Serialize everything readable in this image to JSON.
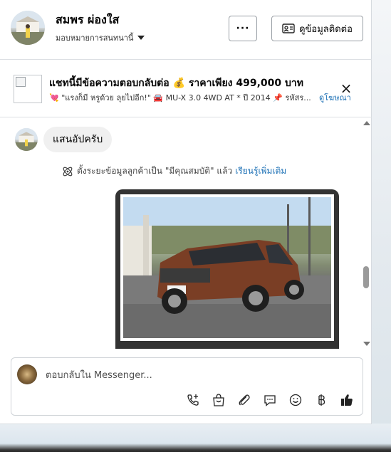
{
  "header": {
    "name": "สมพร ผ่องใส",
    "subtitle": "มอบหมายการสนทนานี้",
    "more_label": "···",
    "contact_label": "ดูข้อมูลติดต่อ"
  },
  "banner": {
    "title": "แชทนี้มีข้อความตอบกลับต่อ 💰 ราคาเพียง 499,000 บาท",
    "detail": "💘 \"แรงก็มี หรูด้วย ลุยไปอีก!\" 🚘 MU-X 3.0 4WD AT * ปี 2014 📌 รหัสร...",
    "link": "ดูโฆษณา",
    "close_label": "×"
  },
  "messages": {
    "bubble_text": "แสนอัปครับ",
    "system_text": "ตั้งระยะข้อมูลลูกค้าเป็น \"มีคุณสมบัติ\" แล้ว",
    "system_link": "เรียนรู้เพิ่มเติม"
  },
  "composer": {
    "placeholder": "ตอบกลับใน Messenger...",
    "tools": [
      "phone-plus-icon",
      "shopping-bag-icon",
      "paperclip-icon",
      "chat-bubble-icon",
      "smiley-icon",
      "baht-icon",
      "thumbs-up-icon"
    ]
  },
  "colors": {
    "accent": "#1a6fb5",
    "bubble_bg": "#f0f0f0",
    "photo_frame": "#333333"
  }
}
